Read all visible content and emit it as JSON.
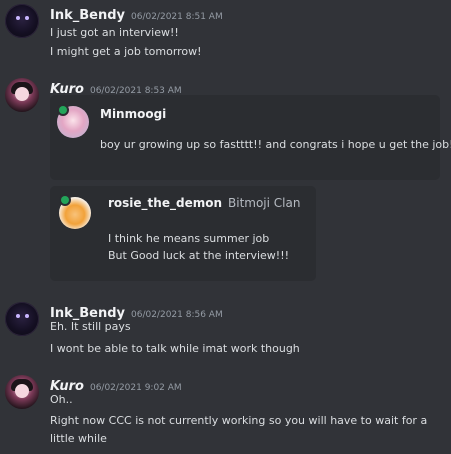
{
  "messages": [
    {
      "username": "Ink_Bendy",
      "timestamp": "06/02/2021 8:51 AM",
      "lines": [
        "I just got an interview!!",
        "I might get a job tomorrow!"
      ]
    },
    {
      "username": "Kuro",
      "timestamp": "06/02/2021 8:53 AM",
      "embeds": [
        {
          "author": "Minmoogi",
          "text_lines": [
            "boy ur growing up so fastttt!! and congrats i hope u get the job!!!"
          ]
        },
        {
          "author": "rosie_the_demon",
          "clan": "Bitmoji Clan",
          "text_lines": [
            "I think he means summer job",
            "But Good luck at the interview!!!"
          ]
        }
      ]
    },
    {
      "username": "Ink_Bendy",
      "timestamp": "06/02/2021 8:56 AM",
      "lines": [
        "Eh. It still pays",
        "I wont be able to talk while imat work though"
      ]
    },
    {
      "username": "Kuro",
      "timestamp": "06/02/2021 9:02 AM",
      "lines": [
        "Oh..",
        "Right now CCC is not currently working so you will have to wait for a",
        "little while"
      ]
    }
  ]
}
